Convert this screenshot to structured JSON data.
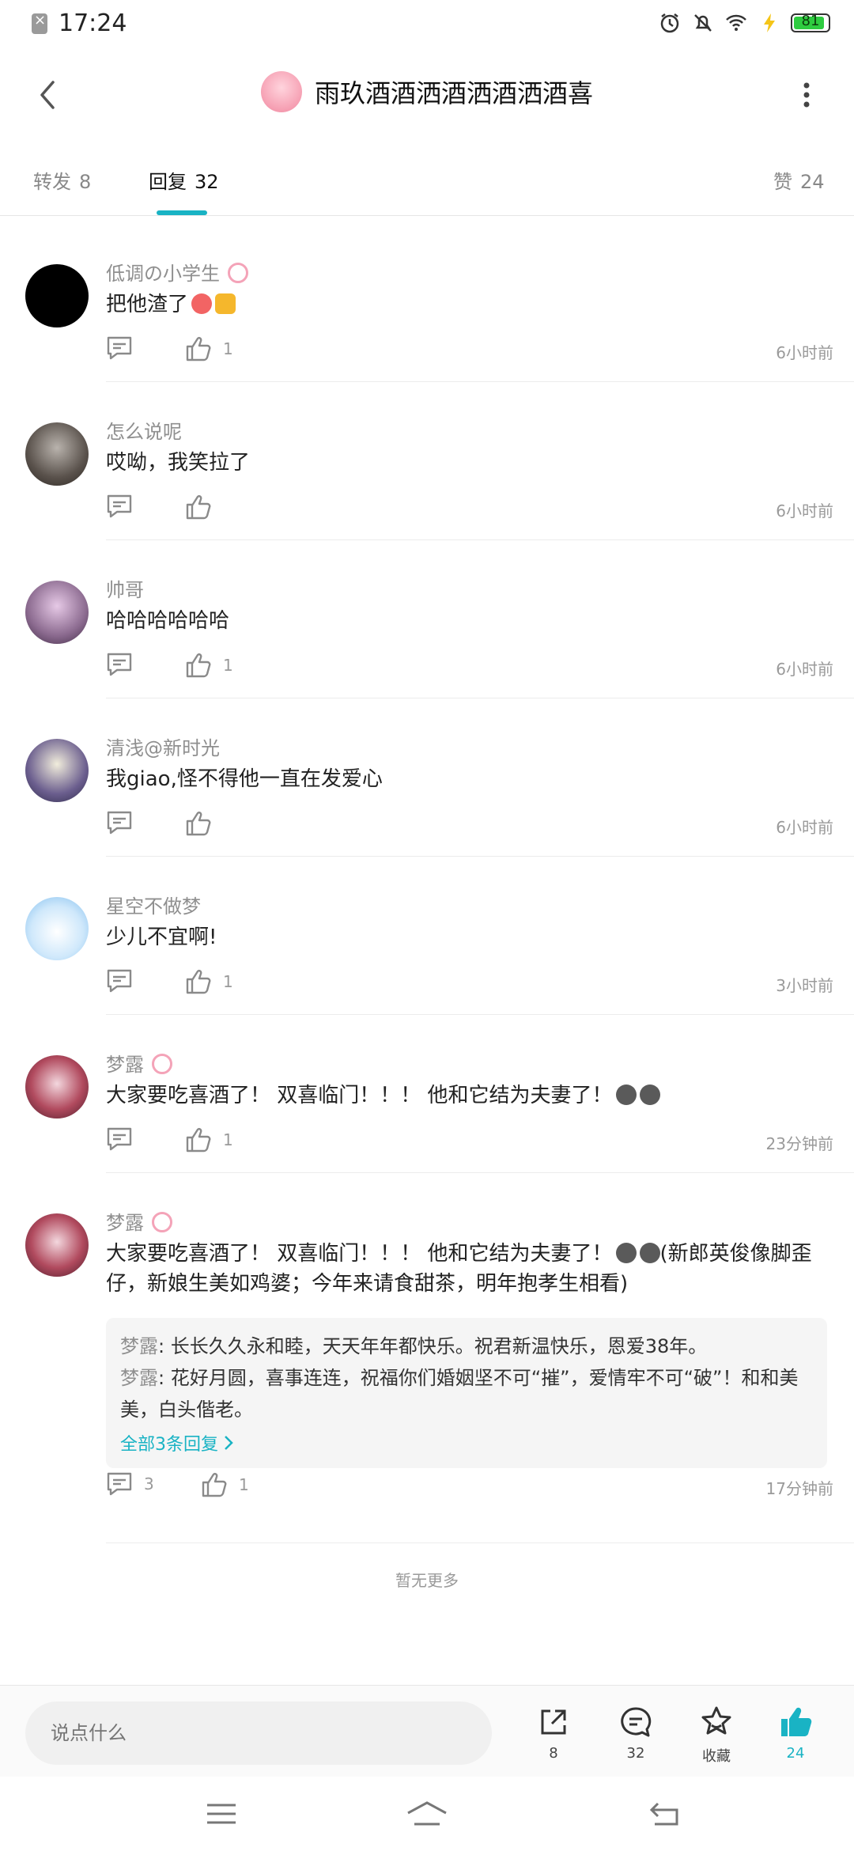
{
  "status_bar": {
    "time": "17:24",
    "battery": "81"
  },
  "header": {
    "title": "雨玖酒酒洒酒洒酒洒酒喜"
  },
  "tabs": [
    {
      "label": "转发",
      "count": "8"
    },
    {
      "label": "回复",
      "count": "32"
    },
    {
      "label": "赞",
      "count": "24"
    }
  ],
  "comments": [
    {
      "name": "低调の小学生",
      "text": "把他渣了",
      "likes": "1",
      "time": "6小时前"
    },
    {
      "name": "怎么说呢",
      "text": "哎呦，我笑拉了",
      "likes": "",
      "time": "6小时前"
    },
    {
      "name": "帅哥",
      "text": "哈哈哈哈哈哈",
      "likes": "1",
      "time": "6小时前"
    },
    {
      "name": "清浅@新时光",
      "text": "我giao,怪不得他一直在发爱心",
      "likes": "",
      "time": "6小时前"
    },
    {
      "name": "星空不做梦",
      "text": "少儿不宜啊!",
      "likes": "1",
      "time": "3小时前"
    },
    {
      "name": "梦露",
      "text": "大家要吃喜酒了！ 双喜临门！！！ 他和它结为夫妻了！",
      "likes": "1",
      "time": "23分钟前"
    },
    {
      "name": "梦露",
      "text_a": "大家要吃喜酒了！ 双喜临门！！！ 他和它结为夫妻了！",
      "text_b": "(新郎英俊像脚歪仔，新娘生美如鸡婆；今年来请食甜茶，明年抱孝生相看)",
      "comments_count": "3",
      "likes": "1",
      "time": "17分钟前",
      "replies": [
        {
          "name": "梦露",
          "text": ": 长长久久永和睦，天天年年都快乐。祝君新温快乐，恩爱38年。"
        },
        {
          "name": "梦露",
          "text": ": 花好月圆，喜事连连，祝福你们婚姻坚不可“摧”，爱情牢不可“破”！和和美美，白头偕老。"
        }
      ],
      "more_replies": "全部3条回复"
    }
  ],
  "no_more": "暂无更多",
  "bottom_bar": {
    "input_placeholder": "说点什么",
    "share_count": "8",
    "comment_count": "32",
    "favorite_label": "收藏",
    "like_count": "24"
  },
  "colors": {
    "accent": "#19b3c4",
    "badge": "#f4a3b8"
  }
}
